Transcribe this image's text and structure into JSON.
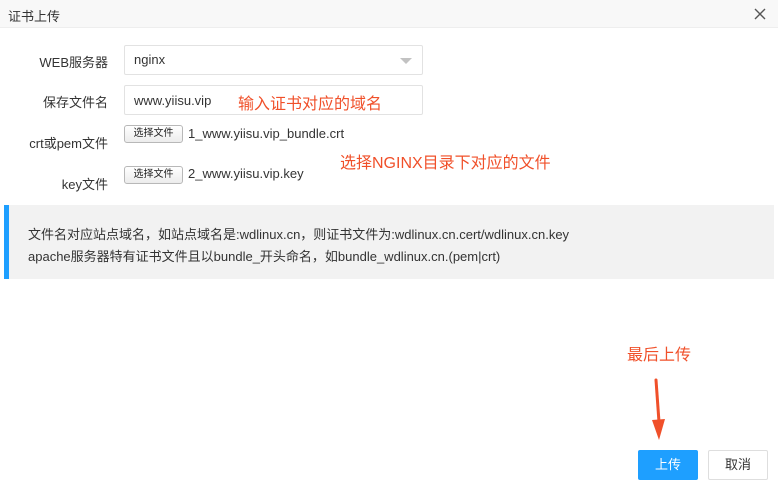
{
  "dialog": {
    "title": "证书上传",
    "close_icon": "close-icon"
  },
  "form": {
    "server": {
      "label": "WEB服务器",
      "value": "nginx"
    },
    "filename": {
      "label": "保存文件名",
      "value": "www.yiisu.vip"
    },
    "crt": {
      "label": "crt或pem文件",
      "button": "选择文件",
      "file": "1_www.yiisu.vip_bundle.crt"
    },
    "key": {
      "label": "key文件",
      "button": "选择文件",
      "file": "2_www.yiisu.vip.key"
    }
  },
  "annotations": {
    "input_hint": "输入证书对应的域名",
    "select_hint": "选择NGINX目录下对应的文件",
    "upload_hint": "最后上传"
  },
  "info": {
    "line1": "文件名对应站点域名，如站点域名是:wdlinux.cn，则证书文件为:wdlinux.cn.cert/wdlinux.cn.key",
    "line2": "apache服务器特有证书文件且以bundle_开头命名，如bundle_wdlinux.cn.(pem|crt)"
  },
  "buttons": {
    "upload": "上传",
    "cancel": "取消"
  },
  "colors": {
    "accent": "#1e9fff",
    "annotation": "#f0502a"
  }
}
